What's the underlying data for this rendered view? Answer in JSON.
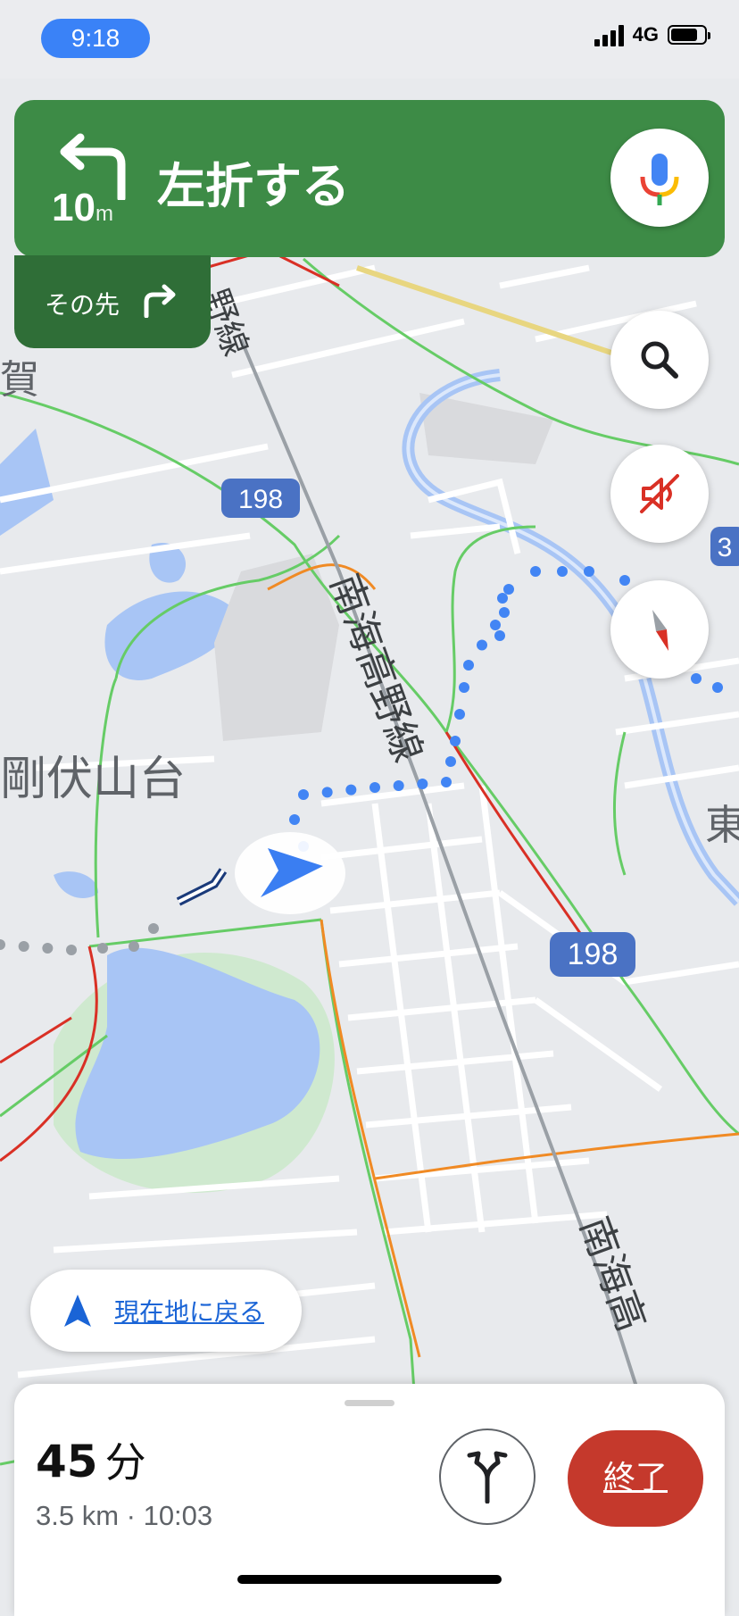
{
  "status_bar": {
    "time": "9:18",
    "network": "4G",
    "battery_level": 0.8
  },
  "navigation": {
    "instruction": "左折する",
    "distance_value": "10",
    "distance_unit": "m",
    "next_label": "その先",
    "turn_icon": "turn-left-icon",
    "next_turn_icon": "turn-right-icon"
  },
  "map": {
    "labels": {
      "area_1": "剛伏山台",
      "area_2": "賀",
      "area_3": "東",
      "railway_1": "南海高野線",
      "railway_2": "野線",
      "railway_3": "南海高",
      "route_shield_1": "198",
      "route_shield_2": "198",
      "route_shield_3": "3"
    }
  },
  "buttons": {
    "search": "search-icon",
    "mute": "sound-muted-icon",
    "compass": "compass-icon",
    "mic": "microphone-icon"
  },
  "recenter": {
    "label": "現在地に戻る"
  },
  "trip": {
    "minutes": "45",
    "unit": "分",
    "summary": "3.5 km · 10:03",
    "end_label": "終了"
  },
  "colors": {
    "nav_green": "#3d8b46",
    "nav_dark_green": "#2f6e37",
    "route_blue": "#3a82f7",
    "end_red": "#c5392c"
  }
}
